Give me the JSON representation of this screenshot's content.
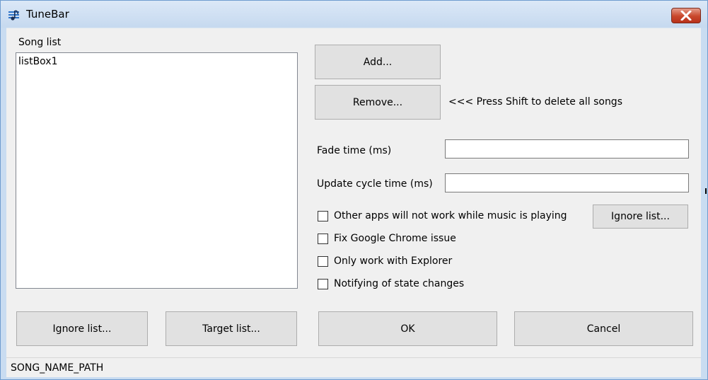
{
  "window": {
    "title": "TuneBar"
  },
  "song_list": {
    "label": "Song list",
    "items": [
      "listBox1"
    ]
  },
  "buttons": {
    "add": "Add...",
    "remove": "Remove...",
    "ignore_list_side": "Ignore list...",
    "ignore_list_bottom": "Ignore list...",
    "target_list": "Target list...",
    "ok": "OK",
    "cancel": "Cancel"
  },
  "hint": "<<< Press Shift to delete all songs",
  "fields": {
    "fade_time": {
      "label": "Fade time (ms)",
      "value": ""
    },
    "update_cycle": {
      "label": "Update cycle time (ms)",
      "value": ""
    }
  },
  "options": [
    {
      "label": "Other apps will not work while music is playing",
      "checked": false
    },
    {
      "label": "Fix Google Chrome issue",
      "checked": false
    },
    {
      "label": "Only work with Explorer",
      "checked": false
    },
    {
      "label": "Notifying of state changes",
      "checked": false
    }
  ],
  "status": "SONG_NAME_PATH",
  "colors": {
    "title_bar": "#c9dcf1",
    "close_button": "#c9472b",
    "client_bg": "#f0f0f0",
    "button_bg": "#e1e1e1"
  },
  "icons": {
    "app": "music-note-icon",
    "close": "close-icon"
  }
}
